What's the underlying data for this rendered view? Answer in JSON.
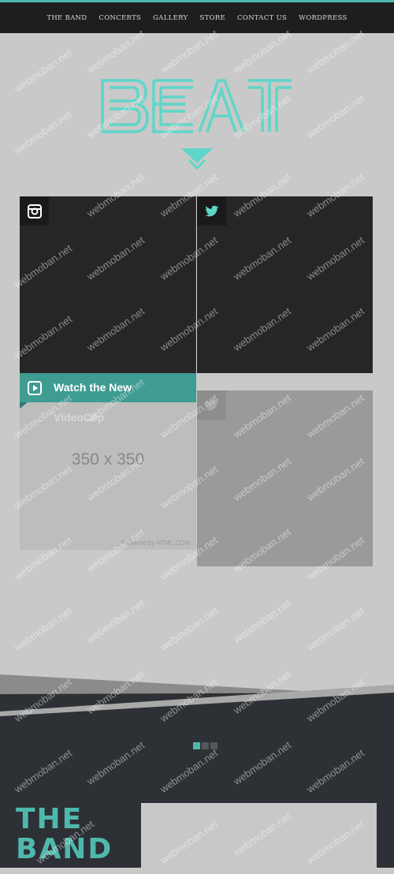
{
  "nav": {
    "items": [
      "THE BAND",
      "CONCERTS",
      "GALLERY",
      "STORE",
      "CONTACT US",
      "WORDPRESS"
    ]
  },
  "hero": {
    "logo_text": "BEAT"
  },
  "tiles": {
    "instagram": {
      "icon": "instagram-icon"
    },
    "twitter": {
      "icon": "twitter-icon"
    },
    "video": {
      "icon": "play-icon",
      "title": "Watch the New",
      "subtitle": "VideoClip",
      "placeholder": "350 x 350",
      "powered": "Powered by HTML.COM"
    },
    "twitter_light": {
      "icon": "twitter-icon"
    }
  },
  "slider": {
    "count": 3,
    "active": 0
  },
  "band": {
    "title_line1": "THE",
    "title_line2": "BAND"
  },
  "watermark": "webmoban.net",
  "colors": {
    "accent": "#4fb8ad",
    "dark": "#262626",
    "band_bg": "#2d3135"
  }
}
